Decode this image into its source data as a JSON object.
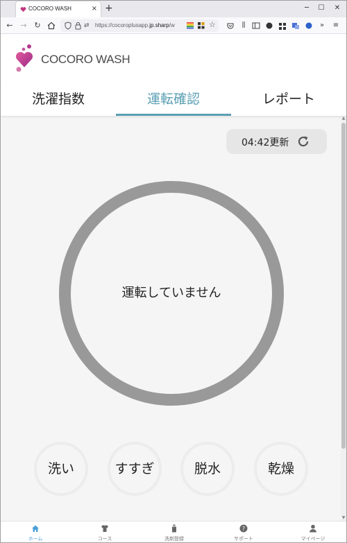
{
  "browser": {
    "tab_title": "COCORO WASH",
    "tab_close": "×",
    "new_tab": "+",
    "url_prefix": "https://cocoroplusapp.",
    "url_domain": "jp.sharp",
    "url_suffix": "/w",
    "window_controls": [
      "─",
      "☐",
      "✕"
    ]
  },
  "app": {
    "brand": "COCORO WASH",
    "accent_color": "#5a9fb3",
    "tabs": [
      {
        "label": "洗濯指数",
        "active": false
      },
      {
        "label": "運転確認",
        "active": true
      },
      {
        "label": "レポート",
        "active": false
      }
    ]
  },
  "main": {
    "update_label": "04:42更新",
    "status_text": "運転していません",
    "steps": [
      "洗い",
      "すすぎ",
      "脱水",
      "乾燥"
    ]
  },
  "bottom_nav": {
    "items": [
      {
        "label": "ホーム",
        "icon": "home-icon",
        "active": true
      },
      {
        "label": "コース",
        "icon": "shirt-icon",
        "active": false
      },
      {
        "label": "洗剤登録",
        "icon": "detergent-icon",
        "active": false
      },
      {
        "label": "サポート",
        "icon": "help-icon",
        "active": false
      },
      {
        "label": "マイページ",
        "icon": "person-icon",
        "active": false
      }
    ]
  }
}
